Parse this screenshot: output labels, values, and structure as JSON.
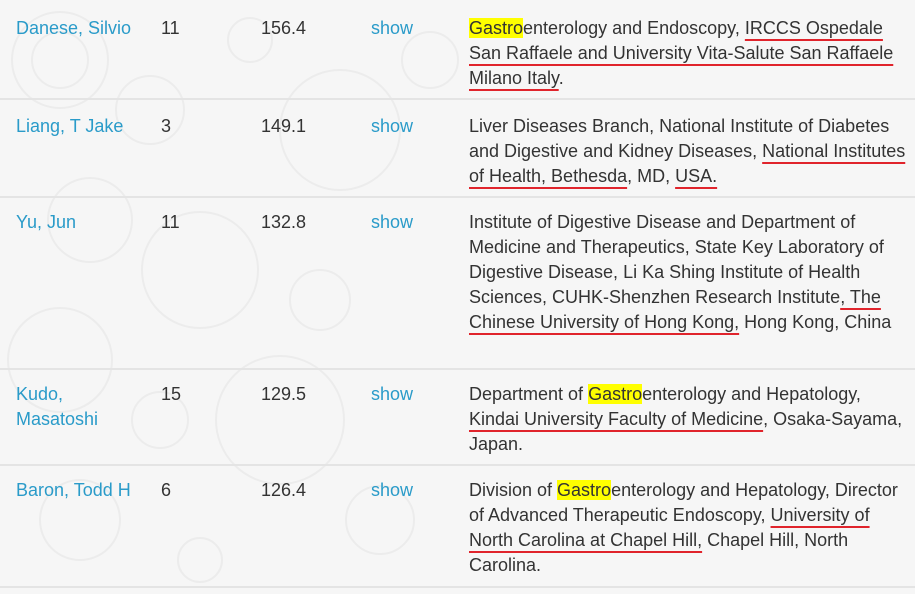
{
  "colors": {
    "link": "#2a9bc9",
    "highlight": "#ffff00",
    "underline": "#e0242c",
    "row_border": "#e4e4e4"
  },
  "rows": [
    {
      "name": "Danese, Silvio",
      "count": "11",
      "score": "156.4",
      "show": "show",
      "affiliation": {
        "highlight": "Gastro",
        "text_a": "enterology and Endoscopy, ",
        "underlined": "IRCCS Ospedale San Raffaele and University Vita-Salute San Raffaele Milano Italy",
        "text_b": "."
      }
    },
    {
      "name": "Liang, T Jake",
      "count": "3",
      "score": "149.1",
      "show": "show",
      "affiliation": {
        "text_a": "Liver Diseases Branch, National Institute of Diabetes and Digestive and Kidney Diseases, ",
        "underlined": "National Institutes of Health, Bethesda",
        "text_b": ", MD, ",
        "underlined_2": "USA.",
        "text_c": ""
      }
    },
    {
      "name": "Yu, Jun",
      "count": "11",
      "score": "132.8",
      "show": "show",
      "affiliation": {
        "text_a": "Institute of Digestive Disease and Department of Medicine and Therapeutics, State Key Laboratory of Digestive Disease, Li Ka Shing Institute of Health Sciences, CUHK-Shenzhen Research Institute",
        "underlined": ", The Chinese University of Hong Kong,",
        "text_b": " Hong Kong, China"
      }
    },
    {
      "name": "Kudo, Masatoshi",
      "count": "15",
      "score": "129.5",
      "show": "show",
      "affiliation": {
        "text_a": "Department of ",
        "highlight": "Gastro",
        "text_b": "enterology and Hepatology, ",
        "underlined": "Kindai University Faculty of Medicine",
        "text_c": ", Osaka-Sayama, Japan."
      }
    },
    {
      "name": "Baron, Todd H",
      "count": "6",
      "score": "126.4",
      "show": "show",
      "affiliation": {
        "text_a": "Division of ",
        "highlight": "Gastro",
        "text_b": "enterology and Hepatology, Director of Advanced Therapeutic Endoscopy, ",
        "underlined": "University of North Carolina at Chapel Hill,",
        "text_c": " Chapel Hill, North Carolina."
      }
    }
  ]
}
